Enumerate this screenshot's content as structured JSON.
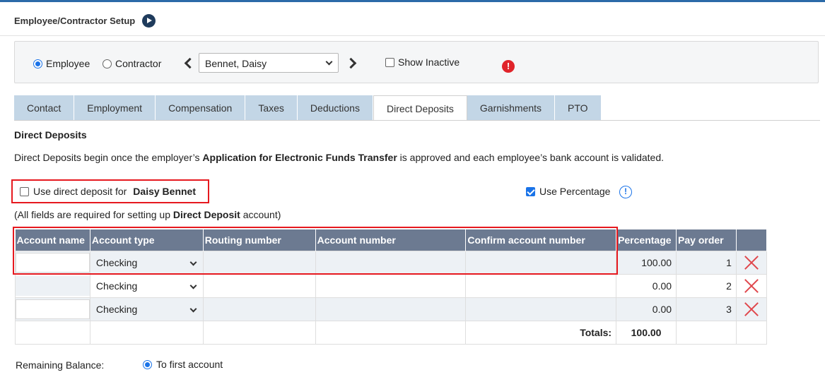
{
  "header": {
    "title": "Employee/Contractor Setup"
  },
  "selector": {
    "employee_label": "Employee",
    "contractor_label": "Contractor",
    "selected_employee": "Bennet, Daisy",
    "show_inactive_label": "Show Inactive",
    "alert_symbol": "!"
  },
  "tabs": [
    {
      "label": "Contact"
    },
    {
      "label": "Employment"
    },
    {
      "label": "Compensation"
    },
    {
      "label": "Taxes"
    },
    {
      "label": "Deductions"
    },
    {
      "label": "Direct Deposits",
      "active": true
    },
    {
      "label": "Garnishments"
    },
    {
      "label": "PTO"
    }
  ],
  "section": {
    "title": "Direct Deposits",
    "desc_pre": "Direct Deposits begin once the employer’s ",
    "desc_bold": "Application for Electronic Funds Transfer",
    "desc_post": " is approved and each employee’s bank account is validated.",
    "use_dd_label": "Use direct deposit for",
    "employee_name": "Daisy Bennet",
    "use_pct_label": "Use Percentage",
    "info_symbol": "!",
    "req_pre": "(All fields are required for setting up ",
    "req_bold": "Direct Deposit",
    "req_post": " account)"
  },
  "table": {
    "headers": [
      "Account name",
      "Account type",
      "Routing number",
      "Account number",
      "Confirm account number",
      "Percentage",
      "Pay order"
    ],
    "rows": [
      {
        "account_name": "",
        "account_type": "Checking",
        "routing": "",
        "account": "",
        "confirm": "",
        "percentage": "100.00",
        "order": "1"
      },
      {
        "account_name": "",
        "account_type": "Checking",
        "routing": "",
        "account": "",
        "confirm": "",
        "percentage": "0.00",
        "order": "2"
      },
      {
        "account_name": "",
        "account_type": "Checking",
        "routing": "",
        "account": "",
        "confirm": "",
        "percentage": "0.00",
        "order": "3"
      }
    ],
    "totals_label": "Totals:",
    "totals_value": "100.00"
  },
  "remaining": {
    "label": "Remaining Balance:",
    "option": "To first account"
  },
  "colors": {
    "accent": "#1a73e8",
    "header_bg": "#6c7a91",
    "tab_bg": "#c3d6e6",
    "highlight": "#e6191f"
  }
}
